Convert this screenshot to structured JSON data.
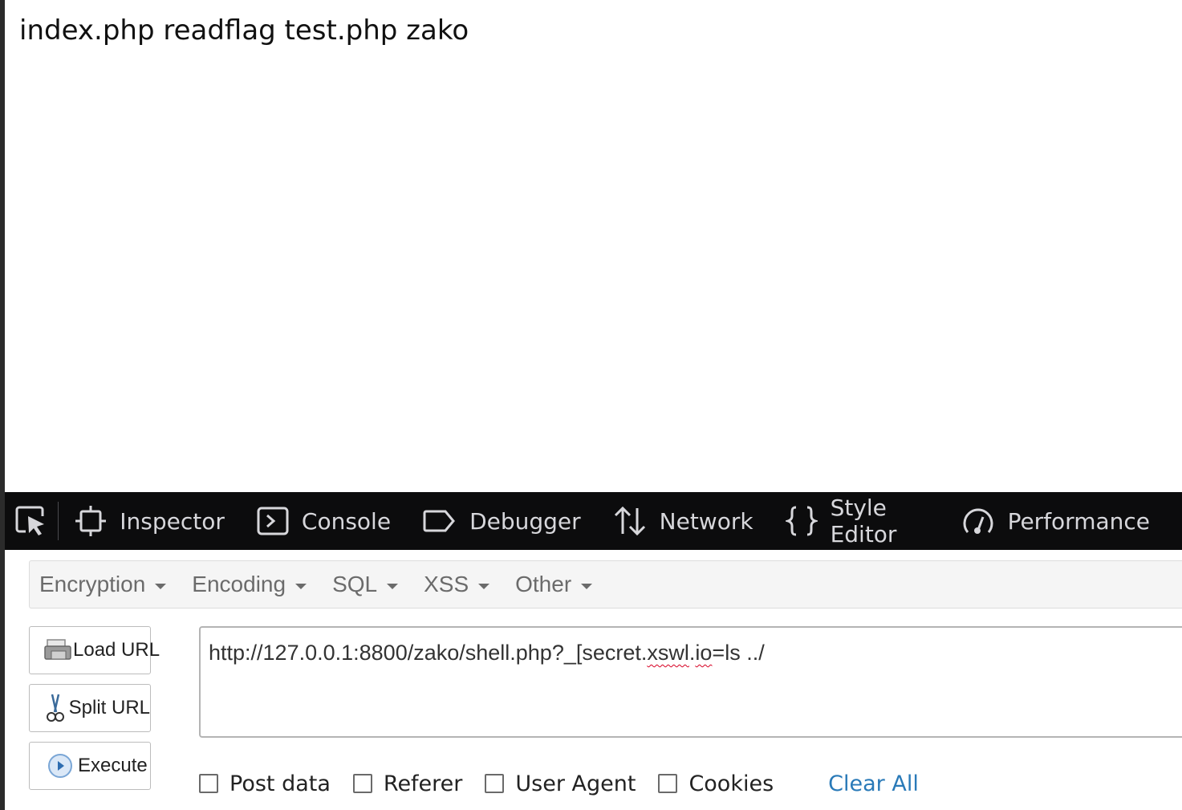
{
  "page": {
    "output": "index.php readflag test.php zako"
  },
  "devtools": {
    "tabs": [
      {
        "label": "Inspector",
        "icon": "frame-icon"
      },
      {
        "label": "Console",
        "icon": "console-icon"
      },
      {
        "label": "Debugger",
        "icon": "debugger-icon"
      },
      {
        "label": "Network",
        "icon": "network-arrows-icon"
      },
      {
        "label": "Style Editor",
        "icon": "braces-icon"
      },
      {
        "label": "Performance",
        "icon": "gauge-icon"
      }
    ],
    "colors": {
      "background": "#0c0c0d",
      "text": "#d7d7db"
    }
  },
  "hackbar": {
    "menu": [
      {
        "label": "Encryption"
      },
      {
        "label": "Encoding"
      },
      {
        "label": "SQL"
      },
      {
        "label": "XSS"
      },
      {
        "label": "Other"
      }
    ],
    "buttons": {
      "load_url": "Load URL",
      "split_url": "Split URL",
      "execute": "Execute"
    },
    "url": {
      "before": "http://127.0.0.1:8800/zako/shell.php?_[secret.",
      "misspelled_1": "xswl",
      "middle": ".",
      "misspelled_2": "io",
      "after": "=ls ../"
    },
    "options": {
      "post_data": "Post data",
      "referer": "Referer",
      "user_agent": "User Agent",
      "cookies": "Cookies",
      "clear_all": "Clear All"
    },
    "colors": {
      "link": "#2a7ab8"
    }
  }
}
